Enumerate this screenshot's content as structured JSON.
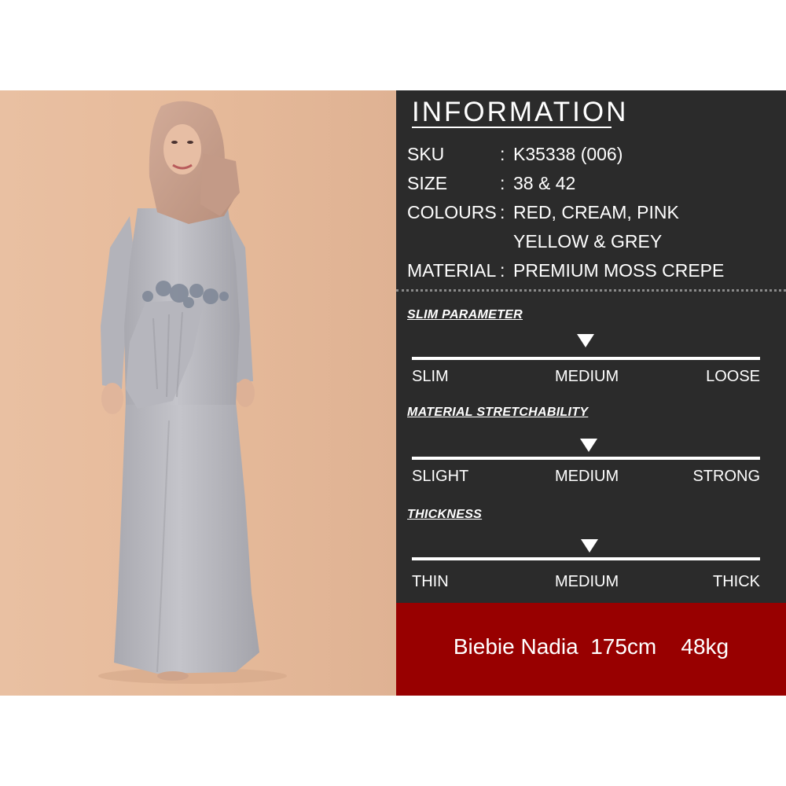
{
  "photo": {
    "background_color": "#e3b899",
    "garment_color": "#b9b9bf",
    "hijab_color": "#c8a08e"
  },
  "info": {
    "title": "INFORMATION",
    "rows": [
      {
        "key": "SKU",
        "colon": ":",
        "value": "K35338 (006)"
      },
      {
        "key": "SIZE",
        "colon": ":",
        "value": "38 & 42"
      },
      {
        "key": "COLOURS",
        "colon": ":",
        "value": "RED, CREAM, PINK"
      },
      {
        "key": "",
        "colon": "",
        "value": "YELLOW & GREY"
      },
      {
        "key": "MATERIAL",
        "colon": ":",
        "value": "PREMIUM MOSS CREPE"
      }
    ]
  },
  "parameters": [
    {
      "title": "SLIM PARAMETER",
      "labels": [
        "SLIM",
        "MEDIUM",
        "LOOSE"
      ],
      "selected": "MEDIUM"
    },
    {
      "title": "MATERIAL STRETCHABILITY",
      "labels": [
        "SLIGHT",
        "MEDIUM",
        "STRONG"
      ],
      "selected": "MEDIUM"
    },
    {
      "title": "THICKNESS",
      "labels": [
        "THIN",
        "MEDIUM",
        "THICK"
      ],
      "selected": "MEDIUM"
    }
  ],
  "model": {
    "name": "Biebie Nadia",
    "height": "175cm",
    "weight": "48kg"
  },
  "colors": {
    "panel": "#2b2b2b",
    "model_bar": "#980000",
    "text": "#ffffff"
  }
}
